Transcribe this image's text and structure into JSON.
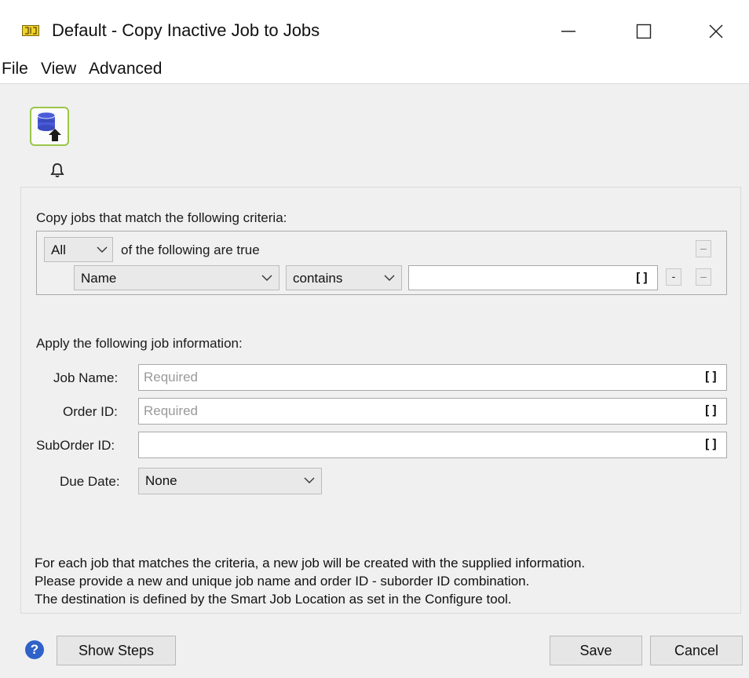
{
  "window": {
    "title": "Default - Copy Inactive Job to Jobs",
    "app_icon": "switch-icon",
    "controls": [
      "minimize-icon",
      "maximize-icon",
      "close-icon"
    ]
  },
  "menu": {
    "items": [
      "File",
      "View",
      "Advanced"
    ]
  },
  "tool": {
    "icon": "database-upload-icon",
    "notification_icon": "bell-icon"
  },
  "criteria": {
    "heading": "Copy jobs that match the following criteria:",
    "match_mode": "All",
    "match_suffix": "of the following are true",
    "rule": {
      "field": "Name",
      "operator": "contains",
      "value": "",
      "variable_icon": "[]"
    },
    "remove_group_label": "–",
    "rule_add_label": "-",
    "rule_remove_label": "–"
  },
  "job_info": {
    "heading": "Apply the following job information:",
    "job_name": {
      "label": "Job Name:",
      "placeholder": "Required",
      "variable_icon": "[]"
    },
    "order_id": {
      "label": "Order ID:",
      "placeholder": "Required",
      "variable_icon": "[]"
    },
    "suborder_id": {
      "label": "SubOrder ID:",
      "placeholder": "",
      "variable_icon": "[]"
    },
    "due_date": {
      "label": "Due Date:",
      "value": "None"
    }
  },
  "info_text": [
    "For each job that matches the criteria, a new job will be created with the supplied information.",
    "Please provide a new and unique job name and order ID - suborder ID combination.",
    "The destination is defined by the Smart Job Location as set in the Configure tool."
  ],
  "footer": {
    "help_icon": "help-icon",
    "help_glyph": "?",
    "show_steps": "Show Steps",
    "save": "Save",
    "cancel": "Cancel"
  },
  "colors": {
    "content_bg": "#f0f0f0",
    "icon_border": "#9cc54a",
    "help_blue": "#2f62c9",
    "db_blue": "#4a5bd8"
  }
}
